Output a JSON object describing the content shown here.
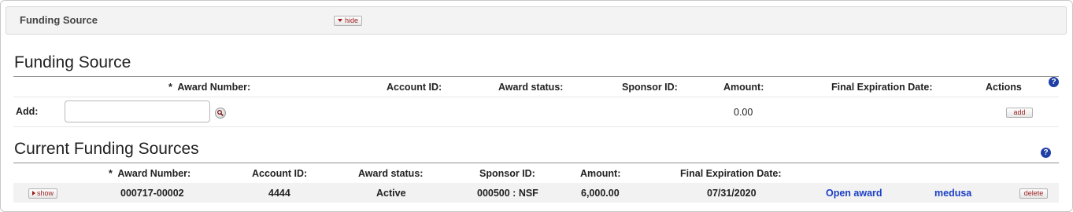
{
  "panel": {
    "title": "Funding Source",
    "hide_label": "hide"
  },
  "add_section": {
    "title": "Funding Source",
    "columns": {
      "award_number": "Award Number:",
      "account_id": "Account ID:",
      "award_status": "Award status:",
      "sponsor_id": "Sponsor ID:",
      "amount": "Amount:",
      "final_expiration": "Final Expiration Date:",
      "actions": "Actions"
    },
    "required_marker": "*",
    "add_label": "Add:",
    "award_number_value": "",
    "amount_value": "0.00",
    "add_button": "add",
    "help": "?"
  },
  "current_section": {
    "title": "Current Funding Sources",
    "columns": {
      "award_number": "Award Number:",
      "account_id": "Account ID:",
      "award_status": "Award status:",
      "sponsor_id": "Sponsor ID:",
      "amount": "Amount:",
      "final_expiration": "Final Expiration Date:"
    },
    "required_marker": "*",
    "help": "?",
    "rows": [
      {
        "show_label": "show",
        "award_number": "000717-00002",
        "account_id": "4444",
        "award_status": "Active",
        "sponsor_id": "000500 : NSF",
        "amount": "6,000.00",
        "final_expiration": "07/31/2020",
        "open_award": "Open award",
        "medusa": "medusa",
        "delete_label": "delete"
      }
    ]
  },
  "colors": {
    "link": "#1a3fc4",
    "help_icon": "#1f3fa6",
    "button_text": "#9a1c1c"
  }
}
